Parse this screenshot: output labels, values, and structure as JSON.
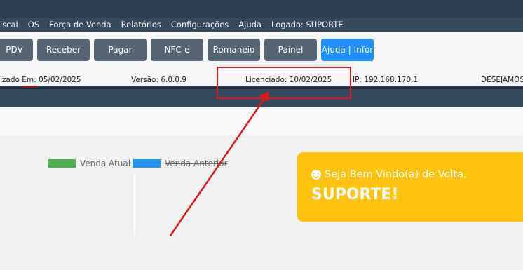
{
  "menu": [
    "iscal",
    "OS",
    "Força de Venda",
    "Relatórios",
    "Configurações",
    "Ajuda",
    "Logado: SUPORTE"
  ],
  "toolbar": {
    "pdv": "PDV",
    "receber": "Receber",
    "pagar": "Pagar",
    "nfce": "NFC-e",
    "romaneio": "Romaneio",
    "painel": "Painel",
    "ajuda": "Ajuda | Infor"
  },
  "status": {
    "atualizado": "izado Em: 05/02/2025",
    "versao": "Versão: 6.0.0.9",
    "licenciado": "Licenciado: 10/02/2025",
    "ip": "IP: 192.168.170.1",
    "desejamos": "DESEJAMOS"
  },
  "legend": {
    "atual": "Venda Atual",
    "anterior": "Venda Anterior",
    "atual_color": "#4caf50",
    "anterior_color": "#2196f3"
  },
  "welcome": {
    "greeting": "Seja Bem Vindo(a) de Volta,",
    "name": "SUPORTE!"
  },
  "colors": {
    "menubar": "#34495e",
    "toolbar_button": "#566573",
    "help_button": "#1e90ff",
    "welcome_card": "#ffc20e",
    "annotation": "#e81515"
  }
}
